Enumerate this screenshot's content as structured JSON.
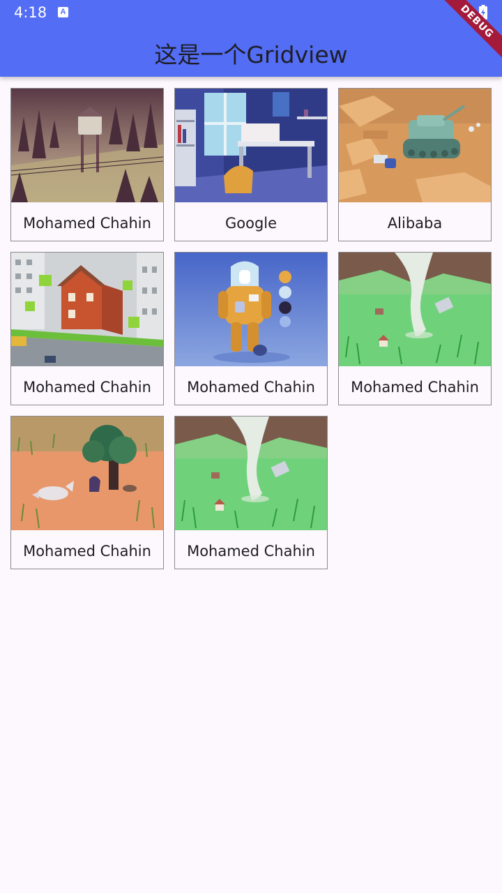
{
  "status_bar": {
    "time": "4:18",
    "icons": [
      "a-notification-icon",
      "wifi-icon",
      "battery-charging-icon"
    ]
  },
  "appbar": {
    "title": "这是一个Gridview",
    "color": "#536df5"
  },
  "debug_banner": {
    "label": "DEBUG",
    "color": "#a31a3b"
  },
  "grid": {
    "items": [
      {
        "label": "Mohamed Chahin",
        "image": "forest-water-tower-illustration"
      },
      {
        "label": "Google",
        "image": "isometric-desk-room-illustration"
      },
      {
        "label": "Alibaba",
        "image": "desert-tank-illustration"
      },
      {
        "label": "Mohamed Chahin",
        "image": "isometric-city-house-illustration"
      },
      {
        "label": "Mohamed Chahin",
        "image": "astronaut-character-illustration"
      },
      {
        "label": "Mohamed Chahin",
        "image": "tornado-field-illustration"
      },
      {
        "label": "Mohamed Chahin",
        "image": "desert-tree-creature-illustration"
      },
      {
        "label": "Mohamed Chahin",
        "image": "tornado-field-illustration"
      }
    ]
  }
}
